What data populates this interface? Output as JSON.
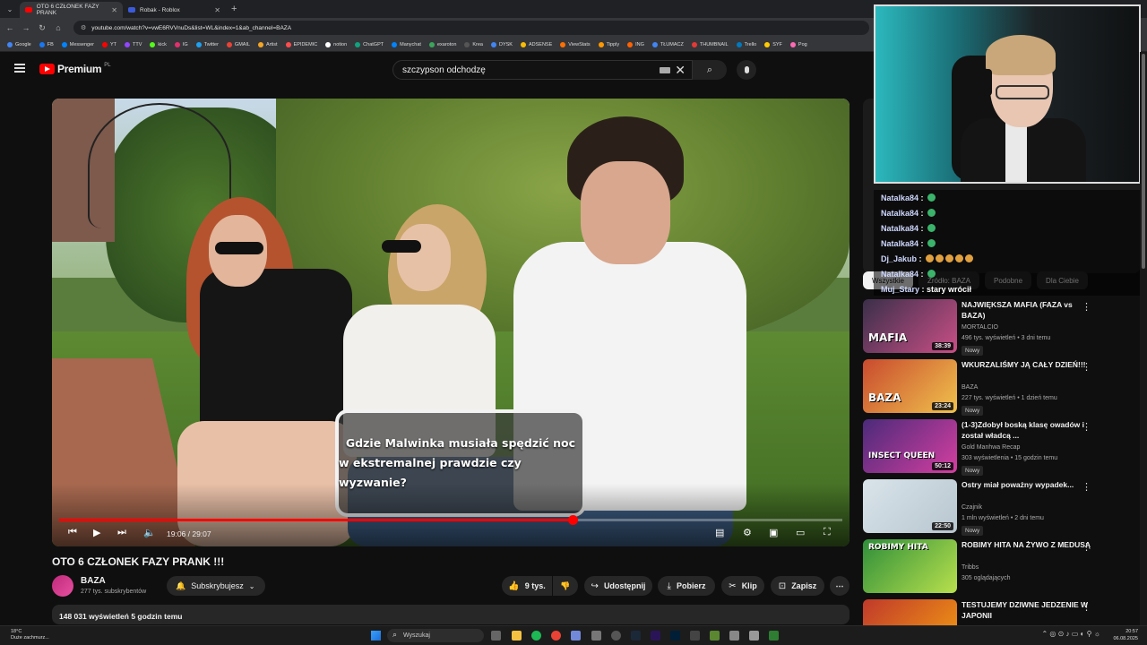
{
  "browser": {
    "tabs": [
      {
        "label": "OTO 6 CZŁONEK FAZY PRANK",
        "active": true,
        "favicon_color": "#ff0000"
      },
      {
        "label": "Robak - Roblox",
        "active": false,
        "favicon_color": "#3b5bdb"
      }
    ],
    "url": "youtube.com/watch?v=vwE6RVVnuDs&list=WL&index=1&ab_channel=BAZA",
    "bookmarks": [
      "Google",
      "FB",
      "Messenger",
      "YT",
      "TTV",
      "kick",
      "IG",
      "Twitter",
      "GMAIL",
      "Artist",
      "EPIDEMIC",
      "notion",
      "ChatGPT",
      "Manychat",
      "exaroton",
      "Krea",
      "DYSK",
      "ADSENSE",
      "ViewStats",
      "Tipply",
      "ING",
      "TŁUMACZ",
      "THUMBNAIL",
      "Trello",
      "SYF",
      "Pog"
    ]
  },
  "youtube": {
    "logo_text": "Premium",
    "country": "PL",
    "search_value": "szczypson odchodzę"
  },
  "video": {
    "caption_line1": "Gdzie Malwinka musiała spędzić noc",
    "caption_line2": "w ekstremalnej prawdzie czy wyzwanie?",
    "time": "19:06 / 29:07",
    "progress": 0.656,
    "title": "OTO 6 CZŁONEK FAZY PRANK !!!",
    "channel": "BAZA",
    "subscribers": "277 tys. subskrybentów",
    "subscribe_label": "Subskrybujesz",
    "likes": "9 tys.",
    "share_label": "Udostępnij",
    "download_label": "Pobierz",
    "clip_label": "Klip",
    "save_label": "Zapisz",
    "description_meta": "148 031 wyświetleń  5 godzin temu"
  },
  "chips": [
    "Wszystkie",
    "Źródło: BAZA",
    "Podobne",
    "Dla Ciebie"
  ],
  "recommendations": [
    {
      "title": "NAJWIĘKSZA MAFIA (FAZA vs BAZA)",
      "channel": "MORTALCIO",
      "meta": "496 tys. wyświetleń • 3 dni temu",
      "badge": "Nowy",
      "duration": "38:39",
      "thumb_text": "MAFIA",
      "colors": [
        "#3a2f4a",
        "#c94f86"
      ]
    },
    {
      "title": "WKURZALIŚMY JĄ CAŁY DZIEŃ!!!",
      "channel": "BAZA",
      "meta": "227 tys. wyświetleń • 1 dzień temu",
      "badge": "Nowy",
      "duration": "23:24",
      "thumb_text": "BAZA",
      "colors": [
        "#c94a2e",
        "#f0c24d"
      ]
    },
    {
      "title": "(1-3)Zdobył boską klasę owadów i został władcą ...",
      "channel": "Gold Manhwa Recap",
      "meta": "303 wyświetlenia • 15 godzin temu",
      "badge": "Nowy",
      "duration": "50:12",
      "thumb_text": "INSECT QUEEN",
      "colors": [
        "#4b2a7a",
        "#d43fa0"
      ]
    },
    {
      "title": "Ostry miał poważny wypadek...",
      "channel": "Czajnik",
      "meta": "1 mln wyświetleń • 2 dni temu",
      "badge": "Nowy",
      "duration": "22:50",
      "thumb_text": "",
      "colors": [
        "#d9e4ea",
        "#b8c6cf"
      ]
    },
    {
      "title": "ROBIMY HITA NA ŻYWO Z MEDUSĄ",
      "channel": "Tribbs",
      "meta": "305 oglądających",
      "badge": "",
      "duration": "",
      "thumb_text": "ROBIMY HITA",
      "colors": [
        "#2f8f3a",
        "#b8e04d"
      ]
    },
    {
      "title": "TESTUJEMY DZIWNE JEDZENIE W JAPONII",
      "channel": "",
      "meta": "",
      "badge": "",
      "duration": "",
      "thumb_text": "",
      "colors": [
        "#c0392b",
        "#f39c12"
      ]
    }
  ],
  "chat": [
    {
      "user": "Natalka84",
      "msg": ""
    },
    {
      "user": "Natalka84",
      "msg": ""
    },
    {
      "user": "Natalka84",
      "msg": ""
    },
    {
      "user": "Natalka84",
      "msg": ""
    },
    {
      "user": "Dj_Jakub",
      "msg": ""
    },
    {
      "user": "Natalka84",
      "msg": ""
    },
    {
      "user": "Muj_Stary",
      "msg": "stary wrócił"
    }
  ],
  "taskbar": {
    "weather_temp": "18°C",
    "weather_desc": "Duże zachmurz...",
    "search_placeholder": "Wyszukaj",
    "time": "20:57",
    "date": "06.08.2025"
  }
}
